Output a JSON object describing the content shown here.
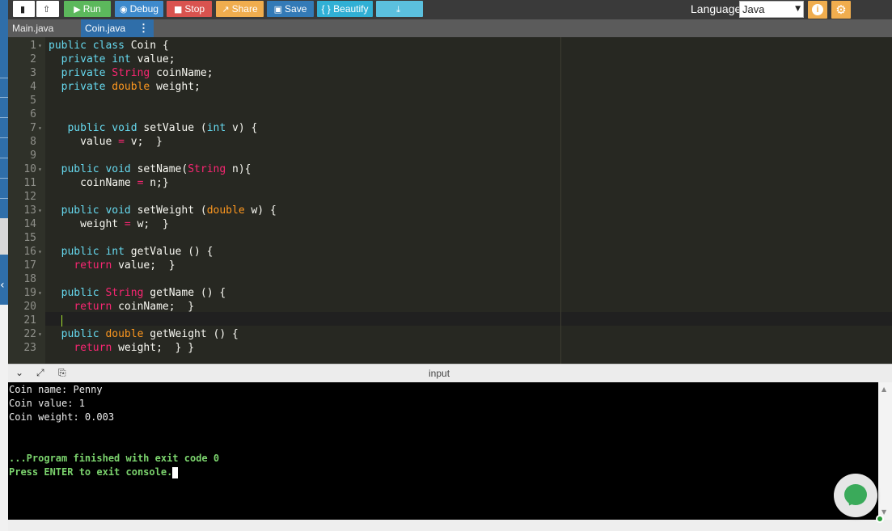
{
  "toolbar": {
    "run_label": "Run",
    "debug_label": "Debug",
    "stop_label": "Stop",
    "share_label": "Share",
    "save_label": "Save",
    "beautify_label": "{ } Beautify",
    "language_label": "Language",
    "language_value": "Java"
  },
  "tabs": [
    {
      "label": "Main.java",
      "active": false
    },
    {
      "label": "Coin.java",
      "active": true
    }
  ],
  "editor": {
    "lines": [
      {
        "n": "1",
        "html": "<span class='kw'>public class</span> Coin {"
      },
      {
        "n": "2",
        "html": "  <span class='kw'>private</span> <span class='kw'>int</span> value;"
      },
      {
        "n": "3",
        "html": "  <span class='kw'>private</span> <span class='st'>String</span> coinName;"
      },
      {
        "n": "4",
        "html": "  <span class='kw'>private</span> <span class='ty'>double</span> weight;"
      },
      {
        "n": "5",
        "html": ""
      },
      {
        "n": "6",
        "html": ""
      },
      {
        "n": "7",
        "html": "   <span class='kw'>public</span> <span class='kw'>void</span> setValue (<span class='kw'>int</span> v) {"
      },
      {
        "n": "8",
        "html": "     value <span class='st'>=</span> v;  }"
      },
      {
        "n": "9",
        "html": ""
      },
      {
        "n": "10",
        "html": "  <span class='kw'>public</span> <span class='kw'>void</span> setName(<span class='st'>String</span> n){"
      },
      {
        "n": "11",
        "html": "     coinName <span class='st'>=</span> n;}"
      },
      {
        "n": "12",
        "html": ""
      },
      {
        "n": "13",
        "html": "  <span class='kw'>public</span> <span class='kw'>void</span> setWeight (<span class='ty'>double</span> w) {"
      },
      {
        "n": "14",
        "html": "     weight <span class='st'>=</span> w;  }"
      },
      {
        "n": "15",
        "html": ""
      },
      {
        "n": "16",
        "html": "  <span class='kw'>public</span> <span class='kw'>int</span> getValue () {"
      },
      {
        "n": "17",
        "html": "    <span class='st'>return</span> value;  }"
      },
      {
        "n": "18",
        "html": ""
      },
      {
        "n": "19",
        "html": "  <span class='kw'>public</span> <span class='st'>String</span> getName () {"
      },
      {
        "n": "20",
        "html": "    <span class='st'>return</span> coinName;  }"
      },
      {
        "n": "21",
        "html": "  <span class='cursor-bar'></span>"
      },
      {
        "n": "22",
        "html": "  <span class='kw'>public</span> <span class='ty'>double</span> getWeight () {"
      },
      {
        "n": "23",
        "html": "    <span class='st'>return</span> weight;  } }"
      }
    ],
    "folds": [
      "1",
      "7",
      "10",
      "13",
      "16",
      "19",
      "22"
    ]
  },
  "console": {
    "title": "input",
    "output": [
      {
        "text": "Coin name: Penny",
        "style": "normal"
      },
      {
        "text": "Coin value: 1",
        "style": "normal"
      },
      {
        "text": "Coin weight: 0.003",
        "style": "normal"
      },
      {
        "text": "",
        "style": "normal"
      },
      {
        "text": "",
        "style": "normal"
      },
      {
        "text": "...Program finished with exit code 0",
        "style": "green"
      },
      {
        "text": "Press ENTER to exit console.",
        "style": "green"
      }
    ]
  }
}
